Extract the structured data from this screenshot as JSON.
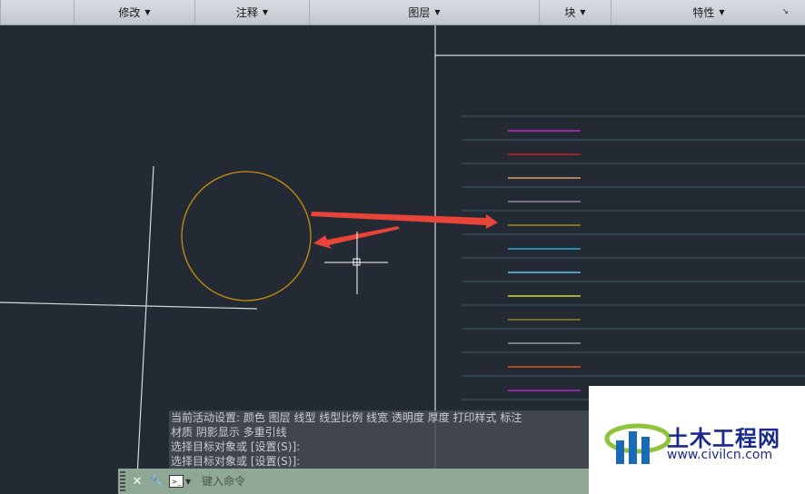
{
  "ribbon": {
    "panels": [
      {
        "label": "修改"
      },
      {
        "label": "注释"
      },
      {
        "label": "图层"
      },
      {
        "label": "块"
      },
      {
        "label": "特性"
      }
    ]
  },
  "command": {
    "history": [
      "当前活动设置:  颜色 图层 线型 线型比例 线宽 透明度 厚度 打印样式 标注",
      "材质 阴影显示 多重引线",
      "选择目标对象或 [设置(S)]:",
      "选择目标对象或 [设置(S)]:"
    ],
    "placeholder": "键入命令"
  },
  "drawing": {
    "circle_color": "#c8900c",
    "arrow_color": "#e8443a",
    "line_swatches": [
      "#c22bd1",
      "#c81f1f",
      "#d8a16a",
      "#9a8aa0",
      "#a08a1a",
      "#2aa6d8",
      "#5ac8e8",
      "#d8d83a",
      "#8a8a2a",
      "#9a9aa0",
      "#d85a1a",
      "#b02ac8"
    ]
  },
  "watermark": {
    "name": "土木工程网",
    "url": "www.civilcn.com"
  }
}
